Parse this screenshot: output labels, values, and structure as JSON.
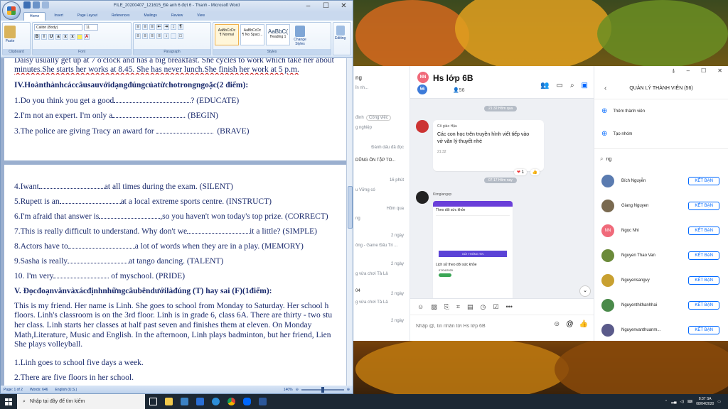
{
  "word": {
    "title": "FILE_20200407_121615_Đề anh 6 đợt 6 - Thanh - Microsoft Word",
    "tabs": [
      "Home",
      "Insert",
      "Page Layout",
      "References",
      "Mailings",
      "Review",
      "View"
    ],
    "ribbon": {
      "paste": "Paste",
      "font_name": "Calibri (Body)",
      "font_size": "11",
      "styles": [
        {
          "sample": "AaBbCcDc",
          "name": "¶ Normal"
        },
        {
          "sample": "AaBbCcDc",
          "name": "¶ No Spaci..."
        },
        {
          "sample": "AaBbC(",
          "name": "Heading 1"
        }
      ],
      "change_styles": "Change Styles",
      "editing": "Editing",
      "groups": [
        "Clipboard",
        "Font",
        "Paragraph",
        "Styles"
      ]
    },
    "doc": {
      "p1_line1": "Daisy usually get up at 7 o'clock and has a big breakfast. She cycles to work which take her about",
      "p1_line2": "minutes.She starts her works at 8.45. She has never lunch.She finish her work at 5 p.m.",
      "sec4_title": "IV.Hoànthànhcáccâusauvớidạngđúngcủatừchotrongngoặc(2 điểm):",
      "q1_a": "1.Do you think you get a good",
      "q1_b": "? (EDUCATE)",
      "q2_a": "2.I'm not an expert. I'm only a",
      "q2_b": ". (BEGIN)",
      "q3_a": "3.The police are giving Tracy an award for",
      "q3_b": "(BRAVE)",
      "q4_a": "4.Iwant",
      "q4_b": "at all times during the exam. (SILENT)",
      "q5_a": "5.Rupett is an",
      "q5_b": "at a local extreme sports centre. (INSTRUCT)",
      "q6_a": "6.I'm afraid that answer is",
      "q6_b": ",so you haven't won today's top prize. (CORRECT)",
      "q7_a": "7.This is really difficult to understand. Why don't we",
      "q7_b": "it a little? (SIMPLE)",
      "q8_a": "8.Actors have to",
      "q8_b": "a lot of words when they are in a play. (MEMORY)",
      "q9_a": "9.Sasha is really",
      "q9_b": "at tango dancing. (TALENT)",
      "q10_a": "10. I'm very",
      "q10_b": "of myschool. (PRIDE)",
      "sec5_title": "V. Đọcđoạnvănvàxácđịnhnhữngcâubêndướilàđúng (T) hay sai (F)(1điểm):",
      "para_l1": "This is my friend. Her name is Linh. She goes to school from Monday to Saturday. Her school h",
      "para_l2": "floors. Linh's classroom is on the 3rd floor. Linh is in grade 6, class 6A. There are thirty - two stu",
      "para_l3": "her class. Linh starts her classes at half past seven and finishes them at eleven. On Monday",
      "para_l4": "Math,Literature, Music and English. In the afternoon, Linh plays badminton, but her friend, Lien",
      "para_l5": "She plays volleyball.",
      "tf1": "1.Linh goes to school five days a week.",
      "tf2": "2.There are five floors in her school."
    },
    "status": {
      "page": "Page: 1 of 2",
      "words": "Words: 646",
      "lang": "English (U.S.)",
      "zoom": "140%"
    }
  },
  "zalo": {
    "list": [
      {
        "text": "ng",
        "sub": "ỉn nh..."
      },
      {
        "text": "đình",
        "sub": "Công việc"
      },
      {
        "text": "g nghiệp",
        "sub": ""
      },
      {
        "text": "Đánh dấu đã đọc",
        "sub": ""
      },
      {
        "text": "DŨNG ÔN TẬP TO...",
        "sub": ""
      },
      {
        "text": "16 phút",
        "sub": "u Vững có"
      },
      {
        "text": "Hôm qua",
        "sub": "ng"
      },
      {
        "text": "2 ngày",
        "sub": "ông - Game Đấu Tri ..."
      },
      {
        "text": "2 ngày",
        "sub": "g vừa chơi Tả Lả"
      },
      {
        "text": "2 ngày",
        "sub": "g vừa chơi Tả Lả"
      },
      {
        "text": "04",
        "sub": ""
      },
      {
        "text": "2 ngày",
        "sub": ""
      }
    ],
    "header": {
      "avatar_text": "NN",
      "group_name": "Hs lớp 6B",
      "avatar2_text": "56",
      "member_count": "56"
    },
    "chat": {
      "time1": "21:32 Hôm qua",
      "sender1": "Cô giáo Hậu",
      "msg1": "Các con học trên truyền hình viết tiếp vào vở văn lý thuyết nhé",
      "msg1_time": "21:32",
      "reaction": "1",
      "time2": "07:17 Hôm nay",
      "sender2": "Kimgiangvp",
      "shot_title": "Theo dõi sức khỏe",
      "shot_sub": "Lịch sử theo dõi sức khỏe",
      "shot_date": "07/04/2020",
      "shot_btn": "GỬI THÔNG TIN"
    },
    "input_placeholder": "Nhập @, tin nhắn tới Hs lớp 6B",
    "members_panel": {
      "title": "QUẢN LÝ THÀNH VIÊN (56)",
      "add_member": "Thêm thành viên",
      "create_group": "Tạo nhóm",
      "search_value": "ng",
      "kb_label": "KẾT BẠN",
      "members": [
        {
          "name": "Bích Nguyễn",
          "color": "#5a7bb0"
        },
        {
          "name": "Giang Nguyen",
          "color": "#7a6a50"
        },
        {
          "name": "Ngọc Nhi",
          "color": "#f06a7a",
          "initials": "NN"
        },
        {
          "name": "Nguyen Thao Van",
          "color": "#6b8a3a"
        },
        {
          "name": "Nguyensangvy",
          "color": "#c8a030"
        },
        {
          "name": "Nguyenthithanhhai",
          "color": "#4a8a4a"
        },
        {
          "name": "Nguyenvanthuanm...",
          "color": "#5a5a8a"
        }
      ]
    }
  },
  "taskbar": {
    "search_placeholder": "Nhập tại đây để tìm kiếm",
    "time": "8:37 SA",
    "date": "08/04/2020"
  }
}
